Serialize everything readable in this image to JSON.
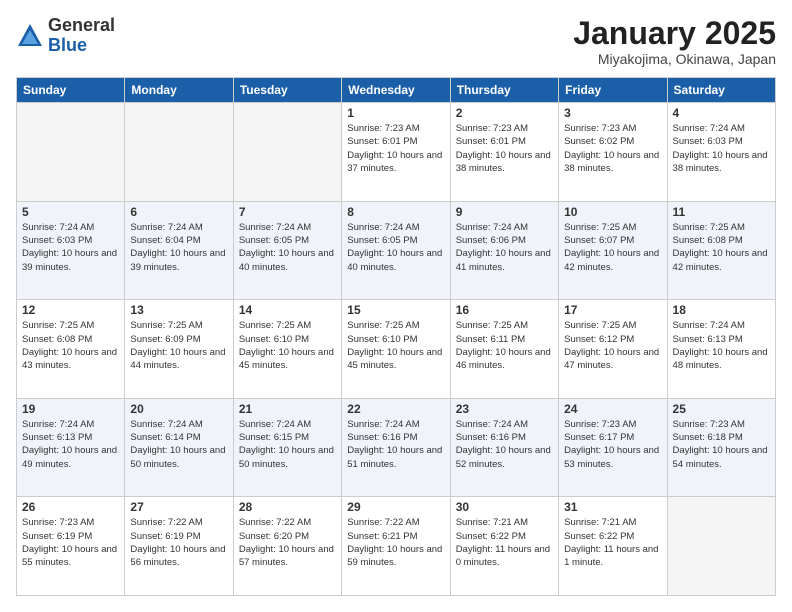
{
  "header": {
    "logo": {
      "general": "General",
      "blue": "Blue"
    },
    "title": "January 2025",
    "subtitle": "Miyakojima, Okinawa, Japan"
  },
  "days_of_week": [
    "Sunday",
    "Monday",
    "Tuesday",
    "Wednesday",
    "Thursday",
    "Friday",
    "Saturday"
  ],
  "weeks": [
    {
      "days": [
        {
          "num": "",
          "info": ""
        },
        {
          "num": "",
          "info": ""
        },
        {
          "num": "",
          "info": ""
        },
        {
          "num": "1",
          "info": "Sunrise: 7:23 AM\nSunset: 6:01 PM\nDaylight: 10 hours\nand 37 minutes."
        },
        {
          "num": "2",
          "info": "Sunrise: 7:23 AM\nSunset: 6:01 PM\nDaylight: 10 hours\nand 38 minutes."
        },
        {
          "num": "3",
          "info": "Sunrise: 7:23 AM\nSunset: 6:02 PM\nDaylight: 10 hours\nand 38 minutes."
        },
        {
          "num": "4",
          "info": "Sunrise: 7:24 AM\nSunset: 6:03 PM\nDaylight: 10 hours\nand 38 minutes."
        }
      ]
    },
    {
      "days": [
        {
          "num": "5",
          "info": "Sunrise: 7:24 AM\nSunset: 6:03 PM\nDaylight: 10 hours\nand 39 minutes."
        },
        {
          "num": "6",
          "info": "Sunrise: 7:24 AM\nSunset: 6:04 PM\nDaylight: 10 hours\nand 39 minutes."
        },
        {
          "num": "7",
          "info": "Sunrise: 7:24 AM\nSunset: 6:05 PM\nDaylight: 10 hours\nand 40 minutes."
        },
        {
          "num": "8",
          "info": "Sunrise: 7:24 AM\nSunset: 6:05 PM\nDaylight: 10 hours\nand 40 minutes."
        },
        {
          "num": "9",
          "info": "Sunrise: 7:24 AM\nSunset: 6:06 PM\nDaylight: 10 hours\nand 41 minutes."
        },
        {
          "num": "10",
          "info": "Sunrise: 7:25 AM\nSunset: 6:07 PM\nDaylight: 10 hours\nand 42 minutes."
        },
        {
          "num": "11",
          "info": "Sunrise: 7:25 AM\nSunset: 6:08 PM\nDaylight: 10 hours\nand 42 minutes."
        }
      ]
    },
    {
      "days": [
        {
          "num": "12",
          "info": "Sunrise: 7:25 AM\nSunset: 6:08 PM\nDaylight: 10 hours\nand 43 minutes."
        },
        {
          "num": "13",
          "info": "Sunrise: 7:25 AM\nSunset: 6:09 PM\nDaylight: 10 hours\nand 44 minutes."
        },
        {
          "num": "14",
          "info": "Sunrise: 7:25 AM\nSunset: 6:10 PM\nDaylight: 10 hours\nand 45 minutes."
        },
        {
          "num": "15",
          "info": "Sunrise: 7:25 AM\nSunset: 6:10 PM\nDaylight: 10 hours\nand 45 minutes."
        },
        {
          "num": "16",
          "info": "Sunrise: 7:25 AM\nSunset: 6:11 PM\nDaylight: 10 hours\nand 46 minutes."
        },
        {
          "num": "17",
          "info": "Sunrise: 7:25 AM\nSunset: 6:12 PM\nDaylight: 10 hours\nand 47 minutes."
        },
        {
          "num": "18",
          "info": "Sunrise: 7:24 AM\nSunset: 6:13 PM\nDaylight: 10 hours\nand 48 minutes."
        }
      ]
    },
    {
      "days": [
        {
          "num": "19",
          "info": "Sunrise: 7:24 AM\nSunset: 6:13 PM\nDaylight: 10 hours\nand 49 minutes."
        },
        {
          "num": "20",
          "info": "Sunrise: 7:24 AM\nSunset: 6:14 PM\nDaylight: 10 hours\nand 50 minutes."
        },
        {
          "num": "21",
          "info": "Sunrise: 7:24 AM\nSunset: 6:15 PM\nDaylight: 10 hours\nand 50 minutes."
        },
        {
          "num": "22",
          "info": "Sunrise: 7:24 AM\nSunset: 6:16 PM\nDaylight: 10 hours\nand 51 minutes."
        },
        {
          "num": "23",
          "info": "Sunrise: 7:24 AM\nSunset: 6:16 PM\nDaylight: 10 hours\nand 52 minutes."
        },
        {
          "num": "24",
          "info": "Sunrise: 7:23 AM\nSunset: 6:17 PM\nDaylight: 10 hours\nand 53 minutes."
        },
        {
          "num": "25",
          "info": "Sunrise: 7:23 AM\nSunset: 6:18 PM\nDaylight: 10 hours\nand 54 minutes."
        }
      ]
    },
    {
      "days": [
        {
          "num": "26",
          "info": "Sunrise: 7:23 AM\nSunset: 6:19 PM\nDaylight: 10 hours\nand 55 minutes."
        },
        {
          "num": "27",
          "info": "Sunrise: 7:22 AM\nSunset: 6:19 PM\nDaylight: 10 hours\nand 56 minutes."
        },
        {
          "num": "28",
          "info": "Sunrise: 7:22 AM\nSunset: 6:20 PM\nDaylight: 10 hours\nand 57 minutes."
        },
        {
          "num": "29",
          "info": "Sunrise: 7:22 AM\nSunset: 6:21 PM\nDaylight: 10 hours\nand 59 minutes."
        },
        {
          "num": "30",
          "info": "Sunrise: 7:21 AM\nSunset: 6:22 PM\nDaylight: 11 hours\nand 0 minutes."
        },
        {
          "num": "31",
          "info": "Sunrise: 7:21 AM\nSunset: 6:22 PM\nDaylight: 11 hours\nand 1 minute."
        },
        {
          "num": "",
          "info": ""
        }
      ]
    }
  ]
}
